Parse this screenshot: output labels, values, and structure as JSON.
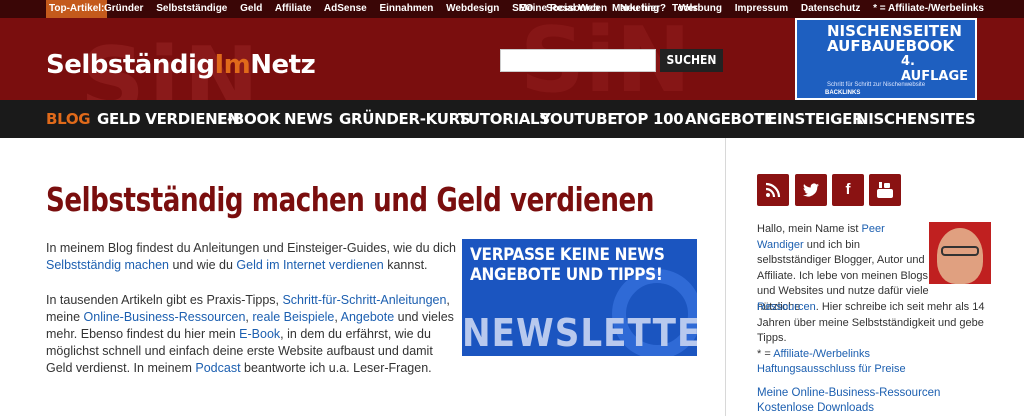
{
  "topbar": {
    "tag": "Top-Artikel:",
    "left_items": [
      "Gründer",
      "Selbstständige",
      "Geld",
      "Affiliate",
      "AdSense",
      "Einnahmen",
      "Webdesign",
      "SEO",
      "Social Web",
      "Marketing",
      "Tools"
    ],
    "right_items": [
      "Meine Ressourcen",
      "Neu hier?",
      "Werbung",
      "Impressum",
      "Datenschutz",
      "* = Affiliate-/Werbelinks"
    ]
  },
  "header": {
    "logo_part1": "Selbständig",
    "logo_part2": "Im",
    "logo_part3": "Netz",
    "search_placeholder": "",
    "search_button": "SUCHEN",
    "ebook_line1": "NISCHENSEITEN",
    "ebook_line2": "AUFBAUEBOOK",
    "ebook_line3": "4. AUFLAGE",
    "ebook_line4": "Schritt für Schritt zur Nischenwebsite",
    "ebook_line5": "BACKLINKS"
  },
  "nav": {
    "items": [
      "BLOG",
      "GELD VERDIENEN",
      "E-BOOK",
      "NEWS",
      "GRÜNDER-KURS",
      "TUTORIALS",
      "YOUTUBE",
      "TOP 100",
      "ANGEBOTE",
      "EINSTEIGER",
      "NISCHENSITES"
    ]
  },
  "main": {
    "title": "Selbstständig machen und Geld verdienen",
    "p1_a": "In meinem Blog findest du Anleitungen und Einsteiger-Guides, wie du dich ",
    "p1_link1": "Selbstständig machen",
    "p1_b": " und wie du ",
    "p1_link2": "Geld im Internet verdienen",
    "p1_c": " kannst.",
    "p2_a": "In tausenden Artikeln gibt es Praxis-Tipps, ",
    "p2_link1": "Schritt-für-Schritt-Anleitungen",
    "p2_b": ", meine ",
    "p2_link2": "Online-Business-Ressourcen",
    "p2_c": ", ",
    "p2_link3": "reale Beispiele",
    "p2_d": ", ",
    "p2_link4": "Angebote",
    "p2_e": " und vieles mehr. Ebenso findest du hier mein ",
    "p2_link5": "E-Book",
    "p2_f": ", in dem du erfährst, wie du möglichst schnell und einfach deine erste Website aufbaust und damit Geld verdienst. In meinem ",
    "p2_link6": "Podcast",
    "p2_g": " beantworte ich u.a. Leser-Fragen.",
    "newsletter_line1": "VERPASSE KEINE NEWS",
    "newsletter_line2": "ANGEBOTE UND TIPPS!",
    "newsletter_big": "NEWSLETTER"
  },
  "sidebar": {
    "social": [
      "rss-icon",
      "twitter-icon",
      "facebook-icon",
      "youtube-icon"
    ],
    "bio_a": "Hallo, mein Name ist ",
    "bio_link": "Peer Wandiger",
    "bio_b": " und ich bin selbstständiger Blogger, Autor und Affiliate. Ich lebe von meinen Blogs und Websites und nutze dafür viele nützliche ",
    "bio_link2": "Ressourcen",
    "bio_c": ". Hier schreibe ich seit mehr als 14 Jahren über meine Selbstständigkeit und gebe Tipps.",
    "affiliate_note": "* = ",
    "affiliate_link": "Affiliate-/Werbelinks",
    "disclaimer": "Haftungsausschluss für Preise",
    "link1": "Meine Online-Business-Ressourcen",
    "link2": "Kostenlose Downloads"
  }
}
